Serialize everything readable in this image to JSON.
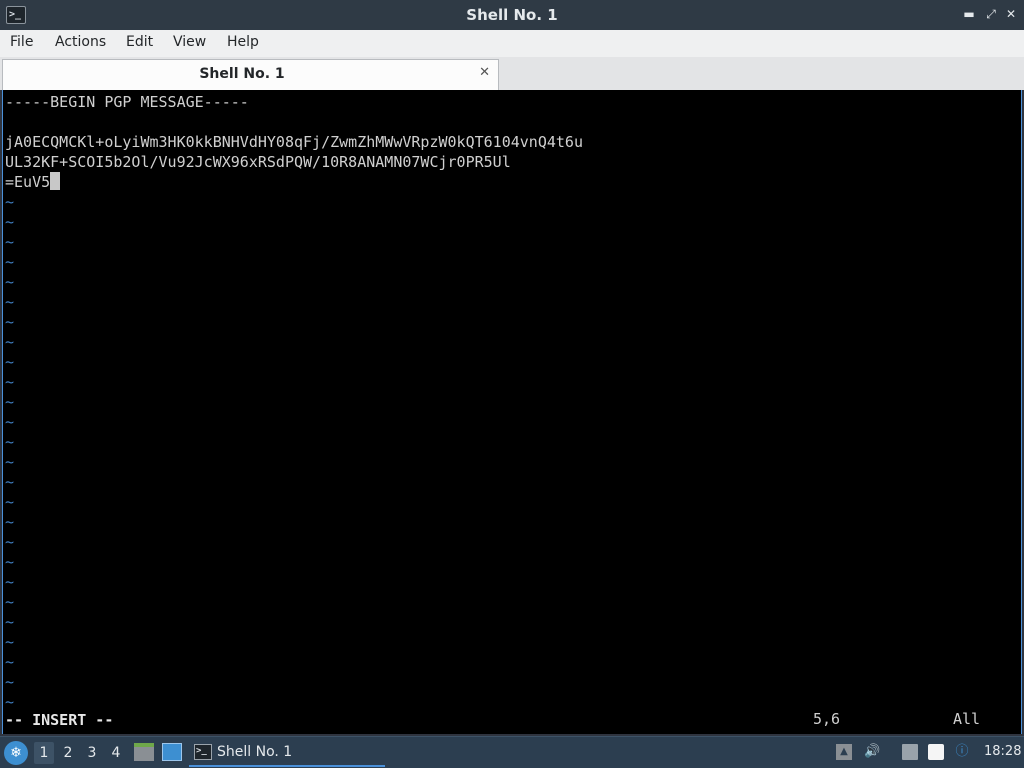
{
  "window": {
    "title": "Shell No. 1",
    "icon": "terminal-icon"
  },
  "menu": {
    "items": [
      "File",
      "Actions",
      "Edit",
      "View",
      "Help"
    ]
  },
  "tabs": [
    {
      "label": "Shell No. 1",
      "close_icon": "close-icon"
    }
  ],
  "terminal": {
    "lines": [
      "-----BEGIN PGP MESSAGE-----",
      "",
      "jA0ECQMCKl+oLyiWm3HK0kkBNHVdHY08qFj/ZwmZhMWwVRpzW0kQT6104vnQ4t6u",
      "UL32KF+SCOI5b2Ol/Vu92JcWX96xRSdPQW/10R8ANAMN07WCjr0PR5Ul",
      "=EuV5"
    ],
    "tilde": "~",
    "status_mode": "-- INSERT --",
    "status_position": "5,6",
    "status_scroll": "All"
  },
  "taskbar": {
    "workspaces": [
      "1",
      "2",
      "3",
      "4"
    ],
    "active_workspace": "1",
    "task_label": "Shell No. 1",
    "clock": "18:28",
    "colors": {
      "accent": "#4a90d9",
      "panel": "#2c3e50",
      "tilde": "#3f7ec0"
    }
  }
}
